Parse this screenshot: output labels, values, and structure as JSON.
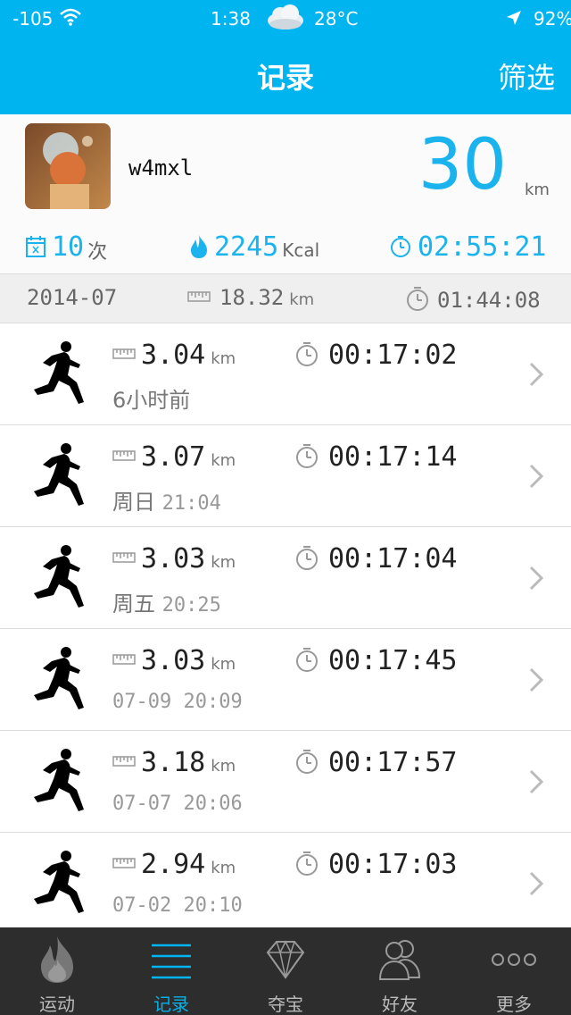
{
  "status_bar": {
    "signal": "-105",
    "time": "1:38",
    "temperature": "28°C",
    "battery": "92%"
  },
  "nav": {
    "title": "记录",
    "filter_label": "筛选"
  },
  "profile": {
    "username": "w4mxl",
    "total_distance": "30",
    "total_distance_unit": "km",
    "count": "10",
    "count_unit": "次",
    "calories": "2245",
    "calories_unit": "Kcal",
    "total_time": "02:55:21"
  },
  "month_summary": {
    "month": "2014-07",
    "distance": "18.32",
    "distance_unit": "km",
    "duration": "01:44:08"
  },
  "records": [
    {
      "distance": "3.04",
      "unit": "km",
      "duration": "00:17:02",
      "date_label": "6小时前",
      "date_time": ""
    },
    {
      "distance": "3.07",
      "unit": "km",
      "duration": "00:17:14",
      "date_label": "周日",
      "date_time": "21:04"
    },
    {
      "distance": "3.03",
      "unit": "km",
      "duration": "00:17:04",
      "date_label": "周五",
      "date_time": "20:25"
    },
    {
      "distance": "3.03",
      "unit": "km",
      "duration": "00:17:45",
      "date_label": "",
      "date_time": "07-09 20:09"
    },
    {
      "distance": "3.18",
      "unit": "km",
      "duration": "00:17:57",
      "date_label": "",
      "date_time": "07-07 20:06"
    },
    {
      "distance": "2.94",
      "unit": "km",
      "duration": "00:17:03",
      "date_label": "",
      "date_time": "07-02 20:10"
    }
  ],
  "tabs": [
    {
      "label": "运动",
      "icon": "flame-icon",
      "active": false
    },
    {
      "label": "记录",
      "icon": "list-icon",
      "active": true
    },
    {
      "label": "夺宝",
      "icon": "diamond-icon",
      "active": false
    },
    {
      "label": "好友",
      "icon": "friends-icon",
      "active": false
    },
    {
      "label": "更多",
      "icon": "more-icon",
      "active": false
    }
  ],
  "colors": {
    "accent": "#00b4ef",
    "tabbar_bg": "#2d2d2d",
    "stat_blue": "#1ab3ee"
  }
}
